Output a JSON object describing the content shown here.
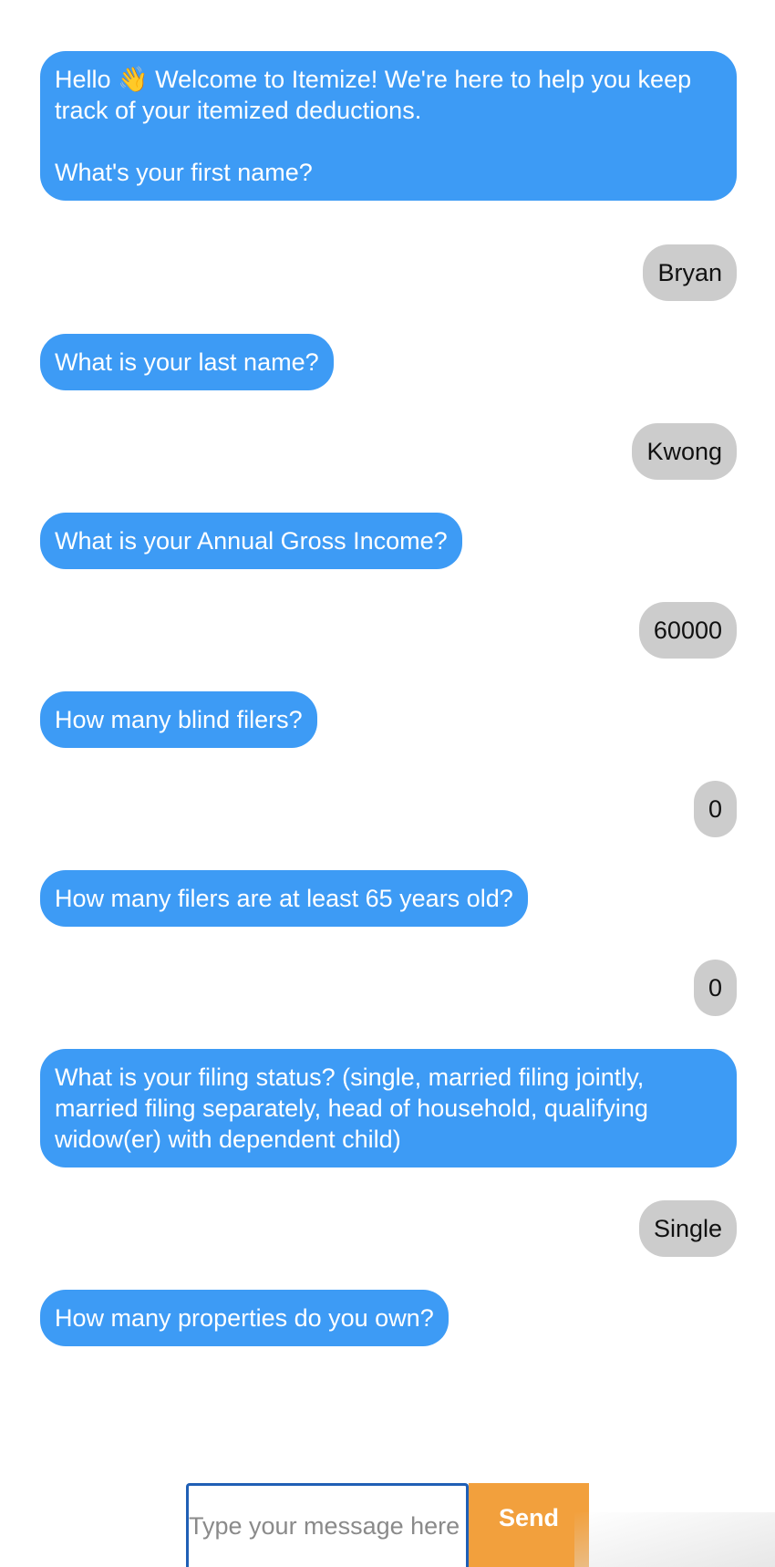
{
  "messages": [
    {
      "from": "bot",
      "text": "Hello 👋 Welcome to Itemize! We're here to help you keep track of your itemized deductions.\n\nWhat's your first name?"
    },
    {
      "from": "user",
      "text": "Bryan"
    },
    {
      "from": "bot",
      "text": "What is your last name?"
    },
    {
      "from": "user",
      "text": "Kwong"
    },
    {
      "from": "bot",
      "text": "What is your Annual Gross Income?"
    },
    {
      "from": "user",
      "text": "60000"
    },
    {
      "from": "bot",
      "text": "How many blind filers?"
    },
    {
      "from": "user",
      "text": "0"
    },
    {
      "from": "bot",
      "text": "How many filers are at least 65 years old?"
    },
    {
      "from": "user",
      "text": "0"
    },
    {
      "from": "bot",
      "text": "What is your filing status? (single, married filing jointly, married filing separately, head of household, qualifying widow(er) with dependent child)"
    },
    {
      "from": "user",
      "text": "Single"
    },
    {
      "from": "bot",
      "text": "How many properties do you own?"
    }
  ],
  "composer": {
    "placeholder": "Type your message here",
    "value": "",
    "send_label": "Send"
  },
  "colors": {
    "bot_bubble": "#3d9bf5",
    "user_bubble": "#cccccc",
    "send_button": "#f2a03d",
    "input_border": "#1f5fb5"
  }
}
